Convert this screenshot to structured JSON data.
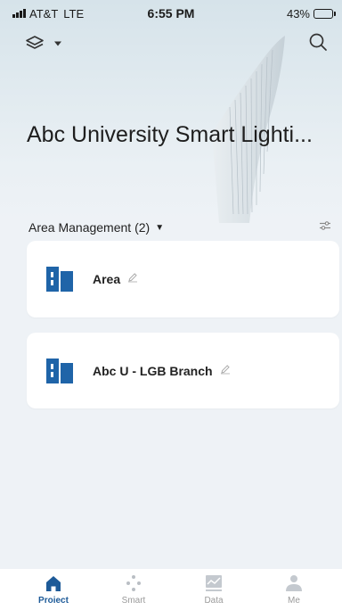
{
  "status_bar": {
    "carrier": "AT&T",
    "network": "LTE",
    "time": "6:55 PM",
    "battery": "43%",
    "battery_level": 0.43
  },
  "header": {
    "project_title": "Abc University Smart Lighti...",
    "layers_icon": "layers-icon",
    "search_icon": "search-icon"
  },
  "section": {
    "title": "Area Management (2)",
    "caret": "▼",
    "filter_icon": "filter-sliders-icon"
  },
  "areas": [
    {
      "name": "Area"
    },
    {
      "name": "Abc U - LGB Branch"
    }
  ],
  "nav": {
    "items": [
      {
        "label": "Proiect",
        "icon": "home-icon",
        "active": true
      },
      {
        "label": "Smart",
        "icon": "dots-icon",
        "active": false
      },
      {
        "label": "Data",
        "icon": "chart-icon",
        "active": false
      },
      {
        "label": "Me",
        "icon": "person-icon",
        "active": false
      }
    ]
  },
  "colors": {
    "accent": "#1d5a98",
    "building_icon": "#1f64a8",
    "inactive": "#9a9a9a",
    "background": "#eef2f6"
  }
}
